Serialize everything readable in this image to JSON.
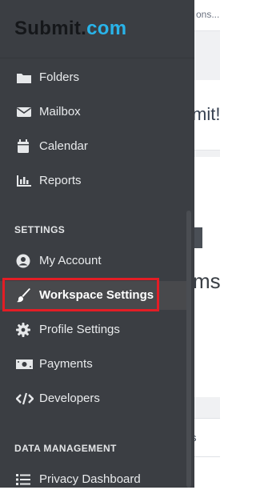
{
  "logo": {
    "brand": "Submit",
    "dot": ".",
    "tld": "com"
  },
  "background": {
    "topbar_text": "ons...",
    "card_text": "mit!",
    "panel_text": "ms",
    "row_text": "s"
  },
  "nav": {
    "items": [
      {
        "label": "Folders",
        "icon": "folder-icon"
      },
      {
        "label": "Mailbox",
        "icon": "envelope-icon"
      },
      {
        "label": "Calendar",
        "icon": "calendar-icon"
      },
      {
        "label": "Reports",
        "icon": "bar-chart-icon"
      }
    ]
  },
  "settings": {
    "title": "SETTINGS",
    "items": [
      {
        "label": "My Account",
        "icon": "user-circle-icon"
      },
      {
        "label": "Workspace Settings",
        "icon": "paint-brush-icon",
        "active": true
      },
      {
        "label": "Profile Settings",
        "icon": "gear-icon"
      },
      {
        "label": "Payments",
        "icon": "money-bill-icon"
      },
      {
        "label": "Developers",
        "icon": "code-icon"
      }
    ]
  },
  "data_management": {
    "title": "DATA MANAGEMENT",
    "items": [
      {
        "label": "Privacy Dashboard",
        "icon": "list-icon"
      }
    ]
  },
  "colors": {
    "sidebar_bg": "#3b3e43",
    "active_bg": "#48494c",
    "highlight_border": "#e31d25",
    "logo_accent": "#29b4ea"
  }
}
